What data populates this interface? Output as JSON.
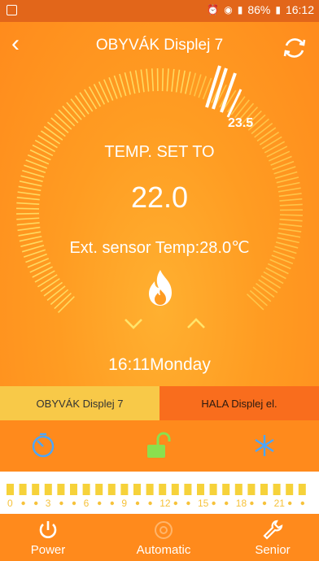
{
  "status_bar": {
    "battery": "86%",
    "time": "16:12"
  },
  "header": {
    "title": "OBYVÁK Displej 7"
  },
  "dial": {
    "label": "TEMP. SET TO",
    "set_value": "22.0",
    "setpoint_marker": "23.5",
    "ext_sensor": "Ext. sensor Temp:28.0℃"
  },
  "clock": {
    "time_day": "16:11Monday"
  },
  "tabs": [
    {
      "label": "OBYVÁK Displej 7",
      "active": true
    },
    {
      "label": "HALA Displej el.",
      "active": false
    }
  ],
  "schedule": {
    "hour_labels": [
      "0",
      "3",
      "6",
      "9",
      "12",
      "15",
      "18",
      "21"
    ]
  },
  "bottom_nav": [
    {
      "label": "Power"
    },
    {
      "label": "Automatic"
    },
    {
      "label": "Senior"
    }
  ],
  "colors": {
    "accent": "#ff8a1c",
    "status_bar": "#e2661a",
    "tab_active": "#f8c948",
    "tab_inactive": "#f96d1d",
    "dial_glow": "#ffe46b",
    "mode_icon": "#4aa6ff",
    "lock_icon": "#8be04e"
  }
}
